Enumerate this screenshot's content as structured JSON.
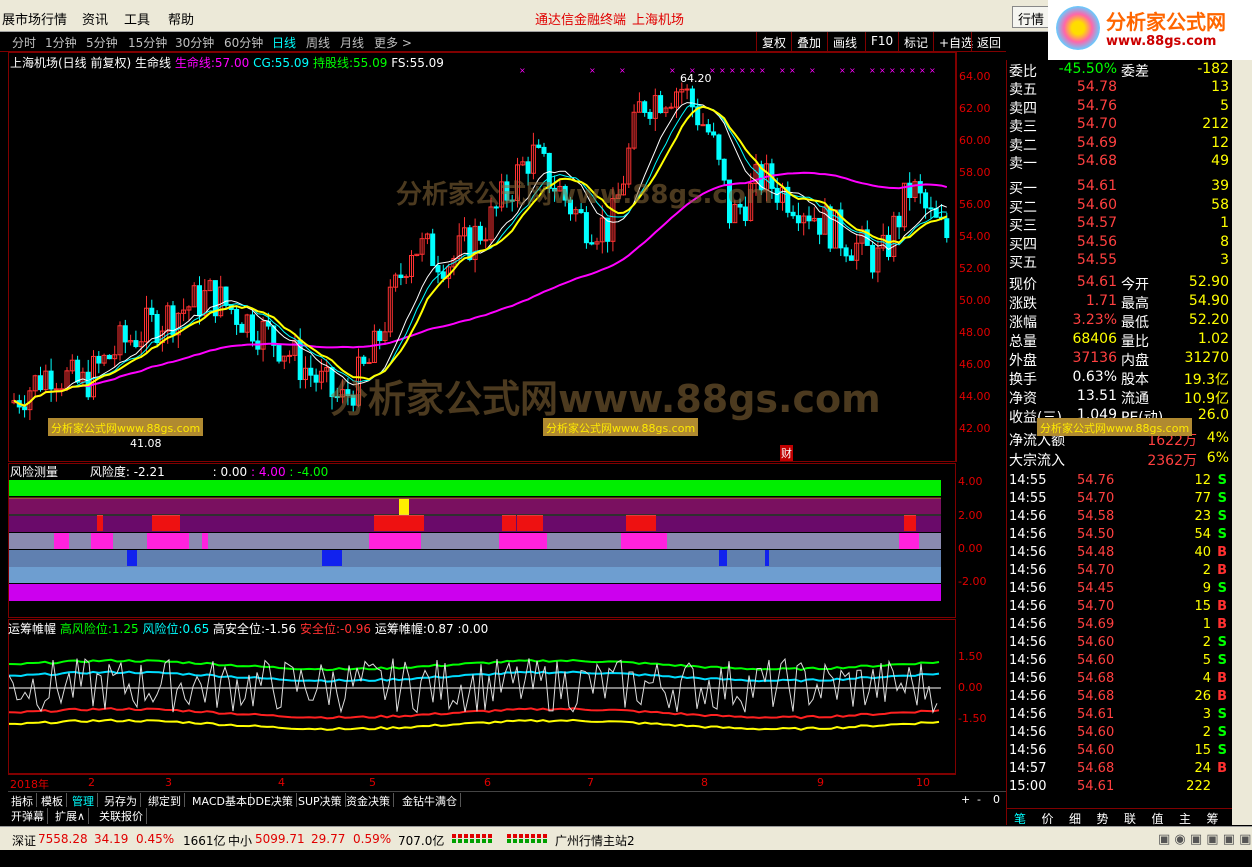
{
  "menu": {
    "items": [
      "展市场行情",
      "资讯",
      "工具",
      "帮助"
    ],
    "center1": "通达信金融终端",
    "center2": "上海机场",
    "btn": "行情"
  },
  "logo": {
    "t1": "分析家公式网",
    "t2": "www.88gs.com"
  },
  "toolbar": {
    "periods": [
      "分时",
      "1分钟",
      "5分钟",
      "15分钟",
      "30分钟",
      "60分钟",
      "日线",
      "周线",
      "月线",
      "更多 >"
    ],
    "selected": "日线",
    "tools": [
      "复权",
      "叠加",
      "画线",
      "F10",
      "标记",
      "+自选",
      "返回"
    ]
  },
  "main": {
    "title": "上海机场(日线 前复权) 生命线",
    "lines": [
      {
        "name": "生命线:",
        "value": "57.00",
        "color": "#ff00ff"
      },
      {
        "name": "CG:",
        "value": "55.09",
        "color": "#00ffff"
      },
      {
        "name": "持股线:",
        "value": "55.09",
        "color": "#00ff00"
      },
      {
        "name": "FS:",
        "value": "55.09",
        "color": "#ffffff"
      }
    ],
    "high_label": "64.20",
    "low_label": "41.08",
    "cai": "财",
    "axis": [
      "64.00",
      "62.00",
      "60.00",
      "58.00",
      "56.00",
      "54.00",
      "52.00",
      "50.00",
      "48.00",
      "46.00",
      "44.00",
      "42.00"
    ]
  },
  "risk": {
    "name": "风险测量",
    "label": "风险度: -2.21",
    "vals": [
      ": 0.00",
      ": 4.00",
      ": -4.00"
    ],
    "axis": [
      "4.00",
      "2.00",
      "0.00",
      "-2.00"
    ]
  },
  "osc": {
    "name": "运筹帷幄",
    "items": [
      {
        "n": "高风险位:",
        "v": "1.25",
        "c": "#00ff00"
      },
      {
        "n": "风险位:",
        "v": "0.65",
        "c": "#00ffff"
      },
      {
        "n": "高安全位:",
        "v": "-1.56",
        "c": "#ffff00"
      },
      {
        "n": "安全位:",
        "v": "-0.96",
        "c": "#ff3030"
      },
      {
        "n": "运筹帷幄:",
        "v": "0.87",
        "c": "#ffffff"
      },
      {
        "n": ":",
        "v": "0.00",
        "c": "#ffffff"
      }
    ],
    "axis": [
      "1.50",
      "0.00",
      "-1.50"
    ]
  },
  "dates": [
    "2018年",
    "2",
    "3",
    "4",
    "5",
    "6",
    "7",
    "8",
    "9",
    "10"
  ],
  "tabs": [
    "指标",
    "模板",
    "管理",
    "另存为",
    "绑定到",
    "MACD基本",
    "DDE决策",
    "SUP决策",
    "资金决策",
    "金钻牛满仓"
  ],
  "tabs_sel": "管理",
  "tabs2": [
    "开弹幕",
    "扩展∧",
    "关联报价"
  ],
  "tabs_ctrl": [
    "+",
    "-",
    "0"
  ],
  "status": {
    "s1": "深证",
    "v1": "7558.28",
    "c1": "34.19",
    "p1": "0.45%",
    "a1": "1661亿",
    "s2": "中小",
    "v2": "5099.71",
    "c2": "29.77",
    "p2": "0.59%",
    "a2": "707.0亿",
    "site": "广州行情主站2"
  },
  "quote": {
    "wb": {
      "label": "委比",
      "value": "-45.50%",
      "label2": "委差",
      "value2": "-182"
    },
    "asks": [
      {
        "l": "卖五",
        "p": "54.78",
        "v": "13"
      },
      {
        "l": "卖四",
        "p": "54.76",
        "v": "5"
      },
      {
        "l": "卖三",
        "p": "54.70",
        "v": "212"
      },
      {
        "l": "卖二",
        "p": "54.69",
        "v": "12"
      },
      {
        "l": "卖一",
        "p": "54.68",
        "v": "49"
      }
    ],
    "bids": [
      {
        "l": "买一",
        "p": "54.61",
        "v": "39"
      },
      {
        "l": "买二",
        "p": "54.60",
        "v": "58"
      },
      {
        "l": "买三",
        "p": "54.57",
        "v": "1"
      },
      {
        "l": "买四",
        "p": "54.56",
        "v": "8"
      },
      {
        "l": "买五",
        "p": "54.55",
        "v": "3"
      }
    ],
    "stats": [
      {
        "a": "现价",
        "b": "54.61",
        "bc": "red",
        "d": "今开",
        "e": "52.90",
        "ec": "wht"
      },
      {
        "a": "涨跌",
        "b": "1.71",
        "bc": "red",
        "d": "最高",
        "e": "54.90",
        "ec": "red"
      },
      {
        "a": "涨幅",
        "b": "3.23%",
        "bc": "red",
        "d": "最低",
        "e": "52.20",
        "ec": "grn"
      },
      {
        "a": "总量",
        "b": "68406",
        "bc": "yel",
        "d": "量比",
        "e": "1.02",
        "ec": "red"
      },
      {
        "a": "外盘",
        "b": "37136",
        "bc": "red",
        "d": "内盘",
        "e": "31270",
        "ec": "grn"
      },
      {
        "a": "换手",
        "b": "0.63%",
        "bc": "wht",
        "d": "股本",
        "e": "19.3亿",
        "ec": "wht"
      },
      {
        "a": "净资",
        "b": "13.51",
        "bc": "wht",
        "d": "流通",
        "e": "10.9亿",
        "ec": "wht"
      },
      {
        "a": "收益(三)",
        "b": "1.049",
        "bc": "wht",
        "d": "PE(动)",
        "e": "26.0",
        "ec": "wht"
      }
    ],
    "flow": [
      {
        "a": "净流入额",
        "b": "1622万",
        "c": "4%"
      },
      {
        "a": "大宗流入",
        "b": "2362万",
        "c": "6%"
      }
    ],
    "ticks": [
      {
        "t": "14:55",
        "p": "54.76",
        "v": "12",
        "s": "S"
      },
      {
        "t": "14:55",
        "p": "54.70",
        "v": "77",
        "s": "S"
      },
      {
        "t": "14:56",
        "p": "54.58",
        "v": "23",
        "s": "S"
      },
      {
        "t": "14:56",
        "p": "54.50",
        "v": "54",
        "s": "S"
      },
      {
        "t": "14:56",
        "p": "54.48",
        "v": "40",
        "s": "B"
      },
      {
        "t": "14:56",
        "p": "54.70",
        "v": "2",
        "s": "B"
      },
      {
        "t": "14:56",
        "p": "54.45",
        "v": "9",
        "s": "S"
      },
      {
        "t": "14:56",
        "p": "54.70",
        "v": "15",
        "s": "B"
      },
      {
        "t": "14:56",
        "p": "54.69",
        "v": "1",
        "s": "B"
      },
      {
        "t": "14:56",
        "p": "54.60",
        "v": "2",
        "s": "S"
      },
      {
        "t": "14:56",
        "p": "54.60",
        "v": "5",
        "s": "S"
      },
      {
        "t": "14:56",
        "p": "54.68",
        "v": "4",
        "s": "B"
      },
      {
        "t": "14:56",
        "p": "54.68",
        "v": "26",
        "s": "B"
      },
      {
        "t": "14:56",
        "p": "54.61",
        "v": "3",
        "s": "S"
      },
      {
        "t": "14:56",
        "p": "54.60",
        "v": "2",
        "s": "S"
      },
      {
        "t": "14:56",
        "p": "54.60",
        "v": "15",
        "s": "S"
      },
      {
        "t": "14:57",
        "p": "54.68",
        "v": "24",
        "s": "B"
      },
      {
        "t": "15:00",
        "p": "54.61",
        "v": "222",
        "s": ""
      }
    ],
    "rtabs": [
      "笔",
      "价",
      "细",
      "势",
      "联",
      "值",
      "主",
      "筹"
    ]
  },
  "watermarks": [
    "分析家公式网www.88gs.com",
    "分析家公式网www.88gs.com"
  ],
  "ads": [
    "分析家公式网www.88gs.com",
    "分析家公式网www.88gs.com",
    "分析家公式网www.88gs.com"
  ],
  "colors": {
    "up": "#ff3232",
    "down": "#00ffff",
    "ma_slow": "#ff00ff",
    "ma_fast": "#ffff00",
    "border": "#800000"
  }
}
